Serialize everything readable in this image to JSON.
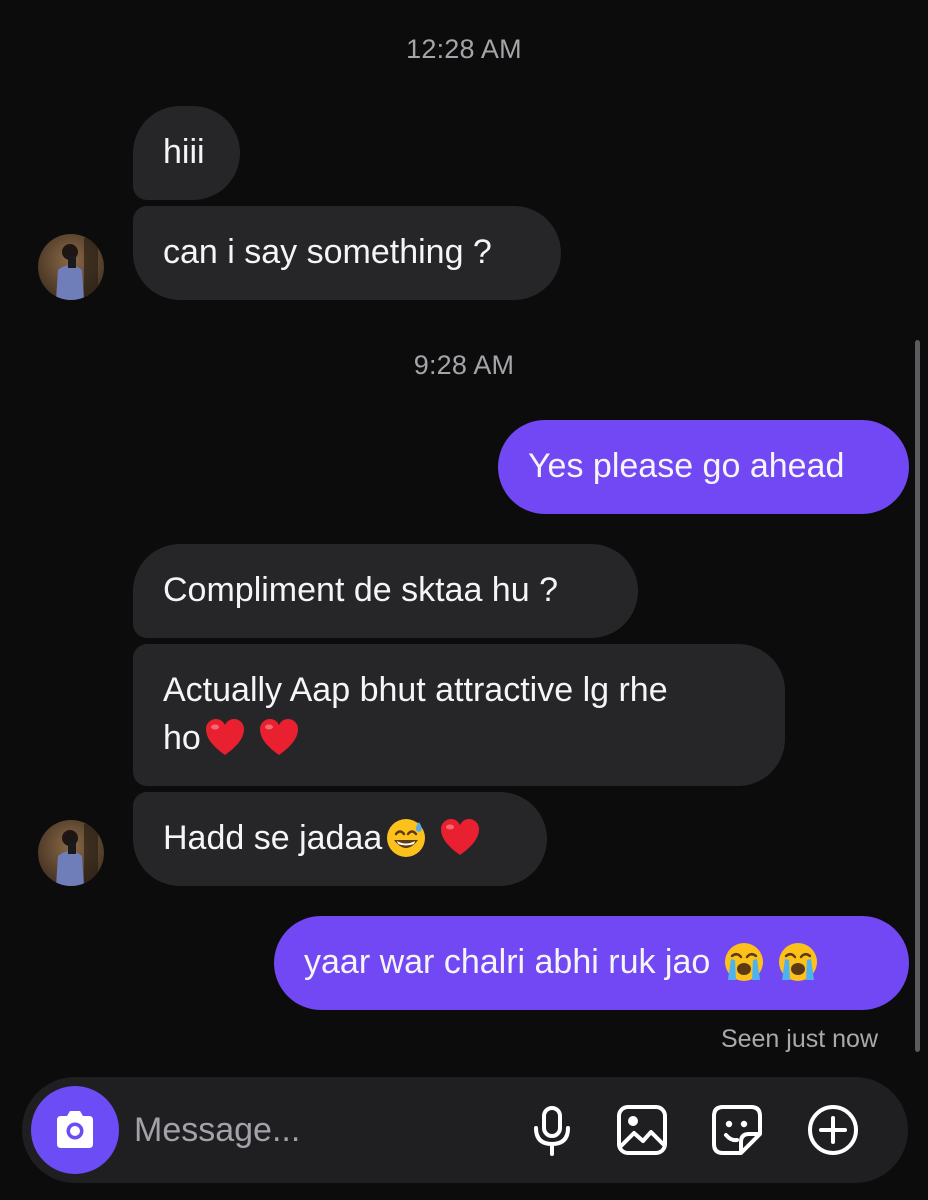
{
  "conversation": {
    "timestamp_1": "12:28 AM",
    "timestamp_2": "9:28 AM",
    "messages": [
      {
        "direction": "incoming",
        "text": "hiii"
      },
      {
        "direction": "incoming",
        "text": "can i say something ?"
      },
      {
        "direction": "outgoing",
        "text": "Yes please go ahead"
      },
      {
        "direction": "incoming",
        "text": "Compliment de sktaa hu ?"
      },
      {
        "direction": "incoming",
        "text": "Actually Aap bhut attractive lg rhe",
        "text_line2": "ho"
      },
      {
        "direction": "incoming",
        "text": "Hadd se jadaa"
      },
      {
        "direction": "outgoing",
        "text": "yaar war chalri abhi ruk jao"
      }
    ],
    "seen_status": "Seen just now"
  },
  "composer": {
    "placeholder": "Message...",
    "icons": [
      "camera-icon",
      "microphone-icon",
      "gallery-icon",
      "sticker-icon",
      "plus-icon"
    ]
  },
  "colors": {
    "background": "#0c0c0d",
    "incoming_bubble": "#262629",
    "outgoing_bubble": "#7248f4",
    "camera_button": "#6c4cf5",
    "timestamp_text": "#a4a4a9"
  }
}
